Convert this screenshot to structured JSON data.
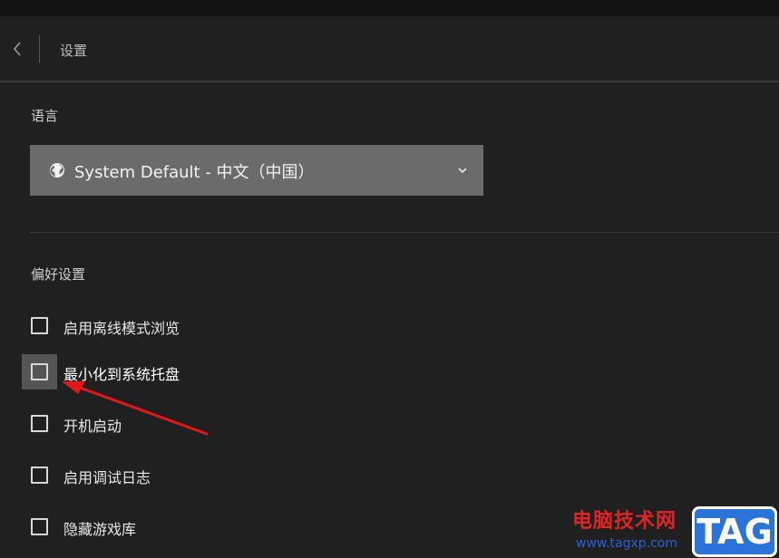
{
  "header": {
    "title": "设置"
  },
  "language": {
    "label": "语言",
    "selected": "System Default - 中文（中国）"
  },
  "preferences": {
    "label": "偏好设置",
    "options": [
      {
        "label": "启用离线模式浏览",
        "checked": false
      },
      {
        "label": "最小化到系统托盘",
        "checked": false
      },
      {
        "label": "开机启动",
        "checked": false
      },
      {
        "label": "启用调试日志",
        "checked": false
      },
      {
        "label": "隐藏游戏库",
        "checked": false
      }
    ]
  },
  "watermark": {
    "site_name": "电脑技术网",
    "url": "www.tagxp.com",
    "badge": "TAG"
  },
  "colors": {
    "background": "#202020",
    "select_background": "#6b6b6b",
    "annotation_arrow": "#e0181b"
  },
  "icons": {
    "back": "chevron-left-icon",
    "globe": "globe-icon",
    "dropdown": "chevron-down-icon"
  }
}
